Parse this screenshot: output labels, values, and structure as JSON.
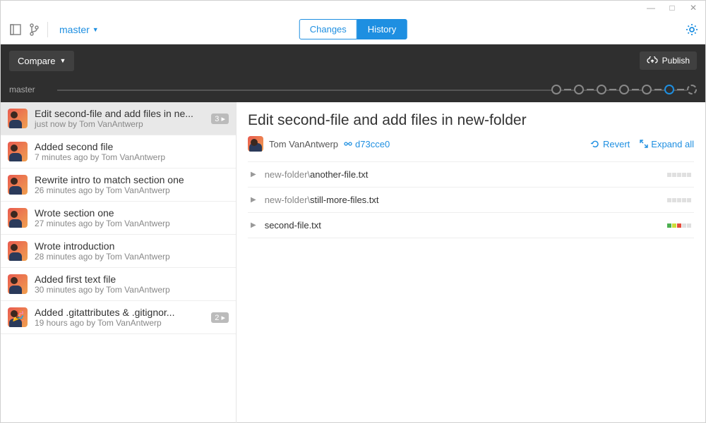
{
  "window": {
    "minimize": "—",
    "maximize": "□",
    "close": "✕"
  },
  "topbar": {
    "branch": "master",
    "tabs": {
      "changes": "Changes",
      "history": "History"
    }
  },
  "dark": {
    "compare": "Compare",
    "publish": "Publish",
    "branch": "master"
  },
  "commits": [
    {
      "title": "Edit second-file and add files in ne...",
      "meta": "just now by Tom VanAntwerp",
      "badge": "3 ▸"
    },
    {
      "title": "Added second file",
      "meta": "7 minutes ago by Tom VanAntwerp"
    },
    {
      "title": "Rewrite intro to match section one",
      "meta": "26 minutes ago by Tom VanAntwerp"
    },
    {
      "title": "Wrote section one",
      "meta": "27 minutes ago by Tom VanAntwerp"
    },
    {
      "title": "Wrote introduction",
      "meta": "28 minutes ago by Tom VanAntwerp"
    },
    {
      "title": "Added first text file",
      "meta": "30 minutes ago by Tom VanAntwerp"
    },
    {
      "title": "Added .gitattributes & .gitignor...",
      "meta": "19 hours ago by Tom VanAntwerp",
      "badge": "2 ▸",
      "party": true
    }
  ],
  "detail": {
    "title": "Edit second-file and add files in new-folder",
    "author": "Tom VanAntwerp",
    "sha": "d73cce0",
    "revert": "Revert",
    "expand": "Expand all",
    "files": [
      {
        "dir": "new-folder\\",
        "name": "another-file.txt",
        "diff": [
          "e",
          "e",
          "e",
          "e",
          "e"
        ]
      },
      {
        "dir": "new-folder\\",
        "name": "still-more-files.txt",
        "diff": [
          "e",
          "e",
          "e",
          "e",
          "e"
        ]
      },
      {
        "dir": "",
        "name": "second-file.txt",
        "diff": [
          "g",
          "y",
          "r",
          "e",
          "e"
        ]
      }
    ]
  }
}
